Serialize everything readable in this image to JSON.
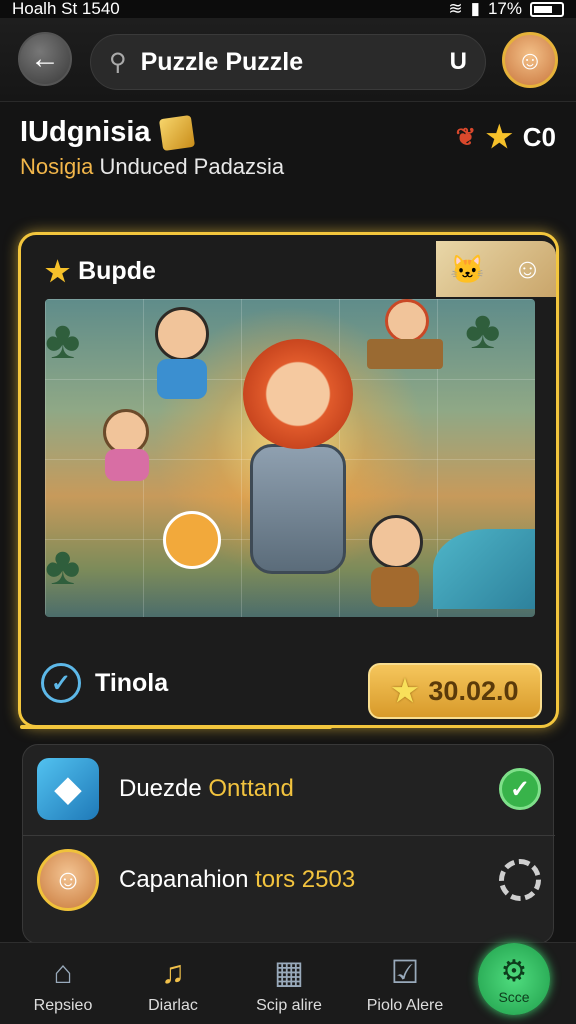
{
  "status": {
    "left": "Hoalh St 1540",
    "battery": "17%"
  },
  "topbar": {
    "search_value": "Puzzle Puzzle",
    "back_icon": "arrow-left-icon",
    "avatar_icon": "avatar-icon"
  },
  "header": {
    "title": "IUdgnisia",
    "subtitle_highlight": "Nosigia",
    "subtitle_rest": " Unduced Padazsia",
    "coins": "C0"
  },
  "card": {
    "title": "Bupde",
    "footer_label": "Tinola",
    "price": "30.02.0"
  },
  "list": {
    "rows": [
      {
        "text": "Duezde ",
        "highlight": "Onttand"
      },
      {
        "text": "Capanahion ",
        "highlight": "tors 2503"
      }
    ]
  },
  "nav": {
    "items": [
      {
        "label": "Repsieo"
      },
      {
        "label": "Diarlac"
      },
      {
        "label": "Scip alire"
      },
      {
        "label": "Piolo Alere"
      },
      {
        "label": "Scce"
      }
    ]
  },
  "colors": {
    "accent": "#f3c63d",
    "success": "#38b34a",
    "info": "#5db8e8"
  }
}
